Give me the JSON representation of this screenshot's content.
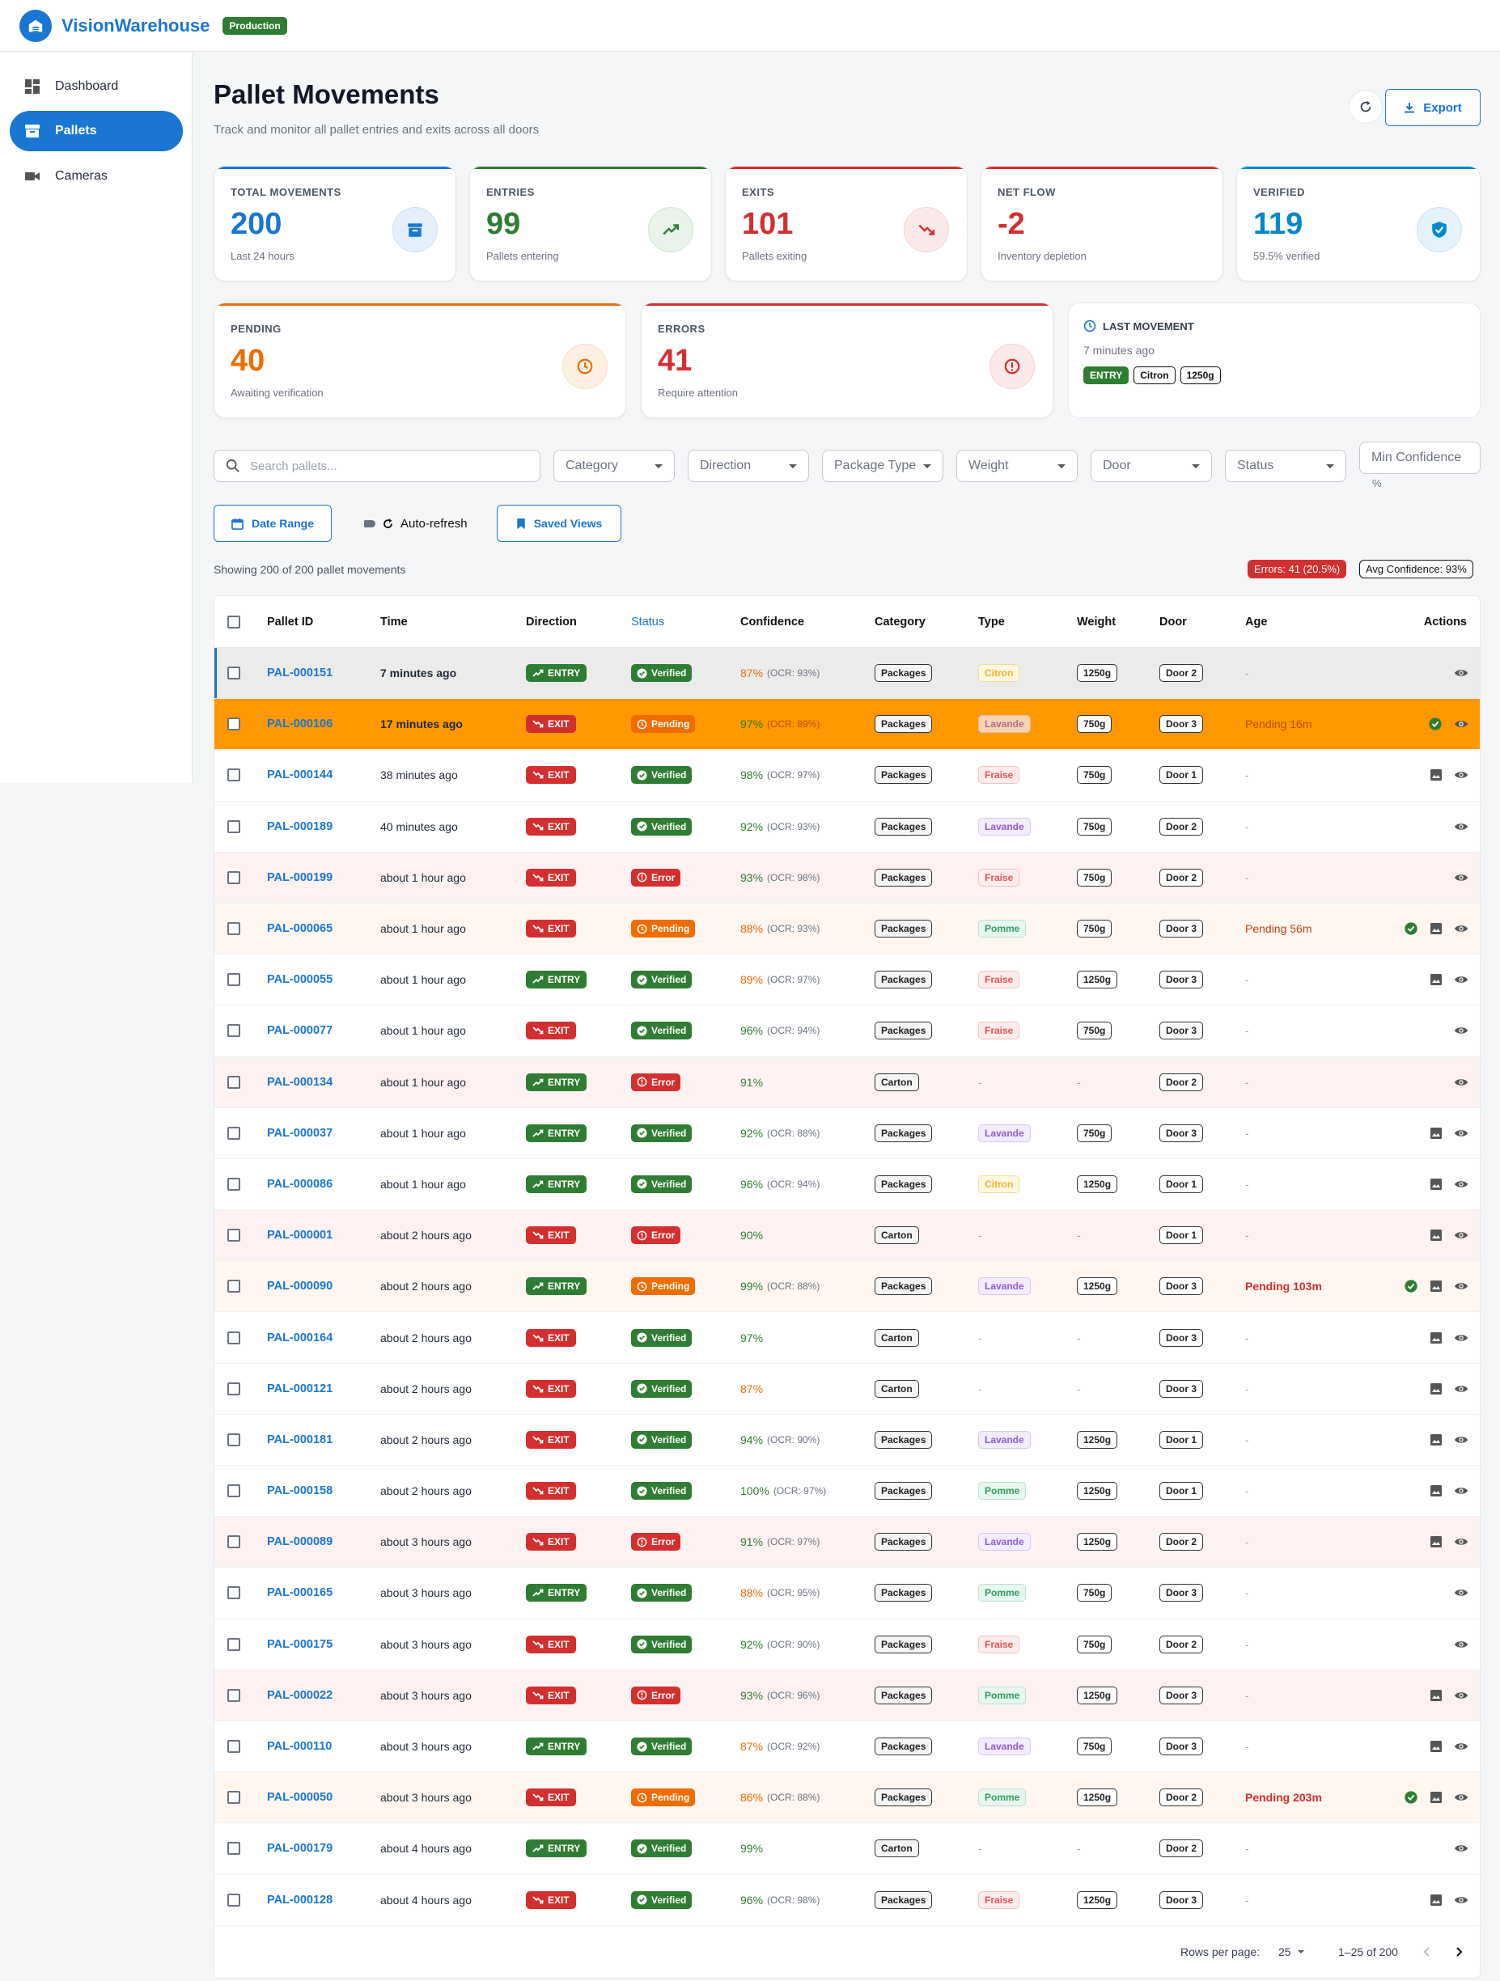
{
  "app": {
    "brand": "VisionWarehouse",
    "env": "Production"
  },
  "sidebar": {
    "items": [
      {
        "label": "Dashboard",
        "icon": "dashboard-icon"
      },
      {
        "label": "Pallets",
        "icon": "pallet-icon"
      },
      {
        "label": "Cameras",
        "icon": "camera-icon"
      }
    ]
  },
  "page": {
    "title": "Pallet Movements",
    "subtitle": "Track and monitor all pallet entries and exits across all doors",
    "export_label": "Export"
  },
  "stats": [
    {
      "label": "TOTAL MOVEMENTS",
      "value": "200",
      "caption": "Last 24 hours",
      "color": "#1976d2",
      "icon": "archive-icon"
    },
    {
      "label": "ENTRIES",
      "value": "99",
      "caption": "Pallets entering",
      "color": "#2e7d32",
      "icon": "trending-up-icon"
    },
    {
      "label": "EXITS",
      "value": "101",
      "caption": "Pallets exiting",
      "color": "#d32f2f",
      "icon": "trending-down-icon"
    },
    {
      "label": "NET FLOW",
      "value": "-2",
      "caption": "Inventory depletion",
      "color": "#d32f2f",
      "icon": ""
    },
    {
      "label": "VERIFIED",
      "value": "119",
      "caption": "59.5% verified",
      "color": "#0288d1",
      "icon": "verified-shield-icon"
    },
    {
      "label": "PENDING",
      "value": "40",
      "caption": "Awaiting verification",
      "color": "#ef6c00",
      "icon": "clock-icon"
    },
    {
      "label": "ERRORS",
      "value": "41",
      "caption": "Require attention",
      "color": "#d32f2f",
      "icon": "error-icon"
    }
  ],
  "last_movement": {
    "label": "LAST MOVEMENT",
    "time": "7 minutes ago",
    "direction": "ENTRY",
    "type": "Citron",
    "weight": "1250g"
  },
  "filters": {
    "search_placeholder": "Search pallets...",
    "selects": [
      "Category",
      "Direction",
      "Package Type",
      "Weight",
      "Door",
      "Status"
    ],
    "min_confidence": "Min Confidence",
    "min_confidence_unit": "%",
    "date_range": "Date Range",
    "auto_refresh": "Auto-refresh",
    "saved_views": "Saved Views"
  },
  "summary": {
    "showing": "Showing 200 of 200 pallet movements",
    "errors_chip": "Errors: 41 (20.5%)",
    "avg_chip": "Avg Confidence: 93%"
  },
  "table": {
    "columns": [
      "Pallet ID",
      "Time",
      "Direction",
      "Status",
      "Confidence",
      "Category",
      "Type",
      "Weight",
      "Door",
      "Age",
      "Actions"
    ],
    "rows": [
      {
        "id": "PAL-000151",
        "time": "7 minutes ago",
        "dir": "ENTRY",
        "status": "Verified",
        "conf": "87%",
        "ocr": "(OCR: 93%)",
        "cat": "Packages",
        "type": "Citron",
        "weight": "1250g",
        "door": "Door 2",
        "age": "-",
        "acts": [
          "view"
        ]
      },
      {
        "id": "PAL-000106",
        "time": "17 minutes ago",
        "dir": "EXIT",
        "status": "Pending",
        "conf": "97%",
        "ocr": "(OCR: 89%)",
        "cat": "Packages",
        "type": "Lavande",
        "weight": "750g",
        "door": "Door 3",
        "age": "Pending 16m",
        "acts": [
          "check",
          "view"
        ]
      },
      {
        "id": "PAL-000144",
        "time": "38 minutes ago",
        "dir": "EXIT",
        "status": "Verified",
        "conf": "98%",
        "ocr": "(OCR: 97%)",
        "cat": "Packages",
        "type": "Fraise",
        "weight": "750g",
        "door": "Door 1",
        "age": "-",
        "acts": [
          "image",
          "view"
        ]
      },
      {
        "id": "PAL-000189",
        "time": "40 minutes ago",
        "dir": "EXIT",
        "status": "Verified",
        "conf": "92%",
        "ocr": "(OCR: 93%)",
        "cat": "Packages",
        "type": "Lavande",
        "weight": "750g",
        "door": "Door 2",
        "age": "-",
        "acts": [
          "view"
        ]
      },
      {
        "id": "PAL-000199",
        "time": "about 1 hour ago",
        "dir": "EXIT",
        "status": "Error",
        "conf": "93%",
        "ocr": "(OCR: 98%)",
        "cat": "Packages",
        "type": "Fraise",
        "weight": "750g",
        "door": "Door 2",
        "age": "-",
        "acts": [
          "view"
        ]
      },
      {
        "id": "PAL-000065",
        "time": "about 1 hour ago",
        "dir": "EXIT",
        "status": "Pending",
        "conf": "88%",
        "ocr": "(OCR: 93%)",
        "cat": "Packages",
        "type": "Pomme",
        "weight": "750g",
        "door": "Door 3",
        "age": "Pending 56m",
        "acts": [
          "check",
          "image",
          "view"
        ]
      },
      {
        "id": "PAL-000055",
        "time": "about 1 hour ago",
        "dir": "ENTRY",
        "status": "Verified",
        "conf": "89%",
        "ocr": "(OCR: 97%)",
        "cat": "Packages",
        "type": "Fraise",
        "weight": "1250g",
        "door": "Door 3",
        "age": "-",
        "acts": [
          "image",
          "view"
        ]
      },
      {
        "id": "PAL-000077",
        "time": "about 1 hour ago",
        "dir": "EXIT",
        "status": "Verified",
        "conf": "96%",
        "ocr": "(OCR: 94%)",
        "cat": "Packages",
        "type": "Fraise",
        "weight": "750g",
        "door": "Door 3",
        "age": "-",
        "acts": [
          "view"
        ]
      },
      {
        "id": "PAL-000134",
        "time": "about 1 hour ago",
        "dir": "ENTRY",
        "status": "Error",
        "conf": "91%",
        "ocr": "",
        "cat": "Carton",
        "type": "-",
        "weight": "-",
        "door": "Door 2",
        "age": "-",
        "acts": [
          "view"
        ]
      },
      {
        "id": "PAL-000037",
        "time": "about 1 hour ago",
        "dir": "ENTRY",
        "status": "Verified",
        "conf": "92%",
        "ocr": "(OCR: 88%)",
        "cat": "Packages",
        "type": "Lavande",
        "weight": "750g",
        "door": "Door 3",
        "age": "-",
        "acts": [
          "image",
          "view"
        ]
      },
      {
        "id": "PAL-000086",
        "time": "about 1 hour ago",
        "dir": "ENTRY",
        "status": "Verified",
        "conf": "96%",
        "ocr": "(OCR: 94%)",
        "cat": "Packages",
        "type": "Citron",
        "weight": "1250g",
        "door": "Door 1",
        "age": "-",
        "acts": [
          "image",
          "view"
        ]
      },
      {
        "id": "PAL-000001",
        "time": "about 2 hours ago",
        "dir": "EXIT",
        "status": "Error",
        "conf": "90%",
        "ocr": "",
        "cat": "Carton",
        "type": "-",
        "weight": "-",
        "door": "Door 1",
        "age": "-",
        "acts": [
          "image",
          "view"
        ]
      },
      {
        "id": "PAL-000090",
        "time": "about 2 hours ago",
        "dir": "ENTRY",
        "status": "Pending",
        "conf": "99%",
        "ocr": "(OCR: 88%)",
        "cat": "Packages",
        "type": "Lavande",
        "weight": "1250g",
        "door": "Door 3",
        "age": "Pending 103m",
        "acts": [
          "check",
          "image",
          "view"
        ]
      },
      {
        "id": "PAL-000164",
        "time": "about 2 hours ago",
        "dir": "EXIT",
        "status": "Verified",
        "conf": "97%",
        "ocr": "",
        "cat": "Carton",
        "type": "-",
        "weight": "-",
        "door": "Door 3",
        "age": "-",
        "acts": [
          "image",
          "view"
        ]
      },
      {
        "id": "PAL-000121",
        "time": "about 2 hours ago",
        "dir": "EXIT",
        "status": "Verified",
        "conf": "87%",
        "ocr": "",
        "cat": "Carton",
        "type": "-",
        "weight": "-",
        "door": "Door 3",
        "age": "-",
        "acts": [
          "image",
          "view"
        ]
      },
      {
        "id": "PAL-000181",
        "time": "about 2 hours ago",
        "dir": "EXIT",
        "status": "Verified",
        "conf": "94%",
        "ocr": "(OCR: 90%)",
        "cat": "Packages",
        "type": "Lavande",
        "weight": "1250g",
        "door": "Door 1",
        "age": "-",
        "acts": [
          "image",
          "view"
        ]
      },
      {
        "id": "PAL-000158",
        "time": "about 2 hours ago",
        "dir": "EXIT",
        "status": "Verified",
        "conf": "100%",
        "ocr": "(OCR: 97%)",
        "cat": "Packages",
        "type": "Pomme",
        "weight": "1250g",
        "door": "Door 1",
        "age": "-",
        "acts": [
          "image",
          "view"
        ]
      },
      {
        "id": "PAL-000089",
        "time": "about 3 hours ago",
        "dir": "EXIT",
        "status": "Error",
        "conf": "91%",
        "ocr": "(OCR: 97%)",
        "cat": "Packages",
        "type": "Lavande",
        "weight": "1250g",
        "door": "Door 2",
        "age": "-",
        "acts": [
          "image",
          "view"
        ]
      },
      {
        "id": "PAL-000165",
        "time": "about 3 hours ago",
        "dir": "ENTRY",
        "status": "Verified",
        "conf": "88%",
        "ocr": "(OCR: 95%)",
        "cat": "Packages",
        "type": "Pomme",
        "weight": "750g",
        "door": "Door 3",
        "age": "-",
        "acts": [
          "view"
        ]
      },
      {
        "id": "PAL-000175",
        "time": "about 3 hours ago",
        "dir": "EXIT",
        "status": "Verified",
        "conf": "92%",
        "ocr": "(OCR: 90%)",
        "cat": "Packages",
        "type": "Fraise",
        "weight": "750g",
        "door": "Door 2",
        "age": "-",
        "acts": [
          "view"
        ]
      },
      {
        "id": "PAL-000022",
        "time": "about 3 hours ago",
        "dir": "EXIT",
        "status": "Error",
        "conf": "93%",
        "ocr": "(OCR: 96%)",
        "cat": "Packages",
        "type": "Pomme",
        "weight": "1250g",
        "door": "Door 3",
        "age": "-",
        "acts": [
          "image",
          "view"
        ]
      },
      {
        "id": "PAL-000110",
        "time": "about 3 hours ago",
        "dir": "ENTRY",
        "status": "Verified",
        "conf": "87%",
        "ocr": "(OCR: 92%)",
        "cat": "Packages",
        "type": "Lavande",
        "weight": "750g",
        "door": "Door 3",
        "age": "-",
        "acts": [
          "image",
          "view"
        ]
      },
      {
        "id": "PAL-000050",
        "time": "about 3 hours ago",
        "dir": "EXIT",
        "status": "Pending",
        "conf": "86%",
        "ocr": "(OCR: 88%)",
        "cat": "Packages",
        "type": "Pomme",
        "weight": "1250g",
        "door": "Door 2",
        "age": "Pending 203m",
        "acts": [
          "check",
          "image",
          "view"
        ]
      },
      {
        "id": "PAL-000179",
        "time": "about 4 hours ago",
        "dir": "ENTRY",
        "status": "Verified",
        "conf": "99%",
        "ocr": "",
        "cat": "Carton",
        "type": "-",
        "weight": "-",
        "door": "Door 2",
        "age": "-",
        "acts": [
          "view"
        ]
      },
      {
        "id": "PAL-000128",
        "time": "about 4 hours ago",
        "dir": "EXIT",
        "status": "Verified",
        "conf": "96%",
        "ocr": "(OCR: 98%)",
        "cat": "Packages",
        "type": "Fraise",
        "weight": "1250g",
        "door": "Door 3",
        "age": "-",
        "acts": [
          "image",
          "view"
        ]
      }
    ]
  },
  "pagination": {
    "rows_label": "Rows per page:",
    "rows_value": "25",
    "range": "1–25 of 200"
  }
}
